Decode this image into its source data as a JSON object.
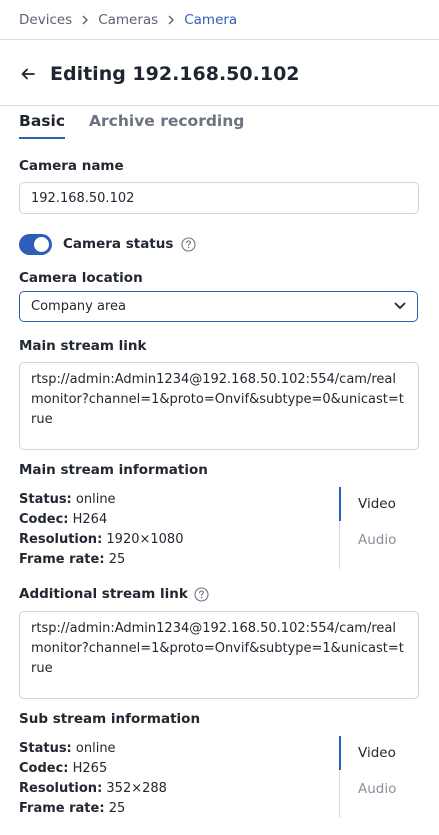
{
  "breadcrumb": {
    "items": [
      "Devices",
      "Cameras",
      "Camera"
    ]
  },
  "header": {
    "title": "Editing 192.168.50.102"
  },
  "tabs": [
    {
      "label": "Basic",
      "active": true
    },
    {
      "label": "Archive recording",
      "active": false
    }
  ],
  "form": {
    "camera_name": {
      "label": "Camera name",
      "value": "192.168.50.102"
    },
    "camera_status": {
      "label": "Camera status",
      "enabled": true
    },
    "camera_location": {
      "label": "Camera location",
      "value": "Company area"
    },
    "main_stream_link": {
      "label": "Main stream link",
      "value": "rtsp://admin:Admin1234@192.168.50.102:554/cam/realmonitor?channel=1&proto=Onvif&subtype=0&unicast=true"
    },
    "main_stream_info": {
      "label": "Main stream information",
      "status_key": "Status:",
      "status": "online",
      "codec_key": "Codec:",
      "codec": "H264",
      "resolution_key": "Resolution:",
      "resolution": "1920×1080",
      "frame_rate_key": "Frame rate:",
      "frame_rate": "25",
      "tabs": [
        "Video",
        "Audio"
      ]
    },
    "additional_stream_link": {
      "label": "Additional stream link",
      "value": "rtsp://admin:Admin1234@192.168.50.102:554/cam/realmonitor?channel=1&proto=Onvif&subtype=1&unicast=true"
    },
    "sub_stream_info": {
      "label": "Sub stream information",
      "status_key": "Status:",
      "status": "online",
      "codec_key": "Codec:",
      "codec": "H265",
      "resolution_key": "Resolution:",
      "resolution": "352×288",
      "frame_rate_key": "Frame rate:",
      "frame_rate": "25",
      "tabs": [
        "Video",
        "Audio"
      ]
    }
  },
  "colors": {
    "accent": "#2e5fb8",
    "border": "#cfd4dc",
    "muted_text": "#8a909a"
  }
}
